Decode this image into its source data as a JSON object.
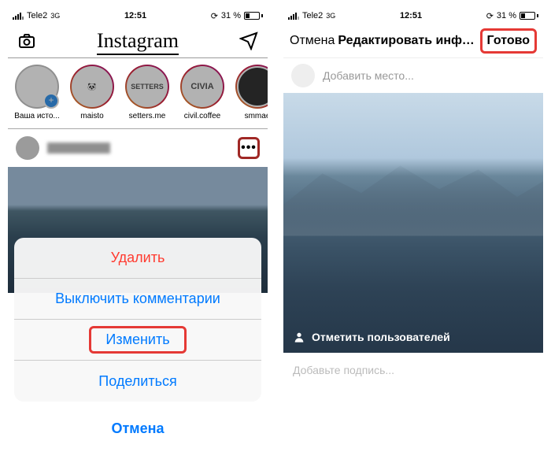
{
  "statusbar": {
    "carrier": "Tele2",
    "time": "12:51",
    "battery": "31 %",
    "network": "3G"
  },
  "left": {
    "app_title": "Instagram",
    "stories": [
      {
        "label": "Ваша исто...",
        "own": true
      },
      {
        "label": "maisto"
      },
      {
        "label": "setters.me"
      },
      {
        "label": "civil.coffee"
      },
      {
        "label": "smmae"
      }
    ],
    "sheet": {
      "delete": "Удалить",
      "disable_comments": "Выключить комментарии",
      "edit": "Изменить",
      "share": "Поделиться",
      "cancel": "Отмена"
    }
  },
  "right": {
    "nav": {
      "cancel": "Отмена",
      "title": "Редактировать информа...",
      "done": "Готово"
    },
    "add_location": "Добавить место...",
    "tag_users": "Отметить пользователей",
    "caption_placeholder": "Добавьте подпись..."
  }
}
